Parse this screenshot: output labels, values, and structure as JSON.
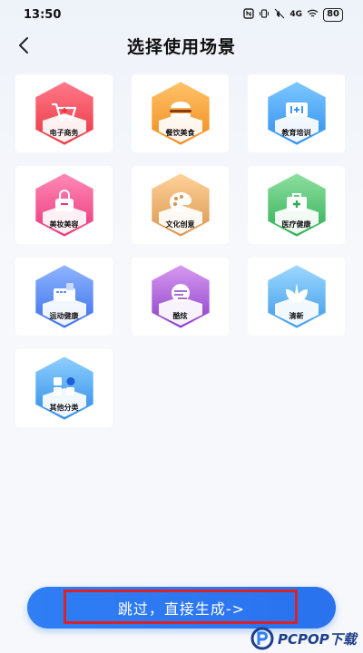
{
  "status_bar": {
    "time": "13:50",
    "icons": [
      "nfc-icon",
      "vibrate-icon",
      "mute-icon",
      "signal-4g-icon",
      "wifi-icon"
    ],
    "network": "4G",
    "battery": "80"
  },
  "header": {
    "title": "选择使用场景",
    "back_icon": "chevron-left-icon"
  },
  "scenes": [
    {
      "label": "电子商务",
      "icon": "cart-icon",
      "color_top": "#ff7a8a",
      "color_bottom": "#e9333f"
    },
    {
      "label": "餐饮美食",
      "icon": "burger-icon",
      "color_top": "#ffc36b",
      "color_bottom": "#f08a1a"
    },
    {
      "label": "教育培训",
      "icon": "education-icon",
      "color_top": "#7ec7ff",
      "color_bottom": "#2c8ef0"
    },
    {
      "label": "美妆美容",
      "icon": "beauty-bag-icon",
      "color_top": "#ff8ab8",
      "color_bottom": "#e93578"
    },
    {
      "label": "文化创意",
      "icon": "palette-icon",
      "color_top": "#ffd29a",
      "color_bottom": "#d9954d"
    },
    {
      "label": "医疗健康",
      "icon": "medical-kit-icon",
      "color_top": "#8fe0a0",
      "color_bottom": "#2fae55"
    },
    {
      "label": "运动健康",
      "icon": "sport-icon",
      "color_top": "#8eb5ff",
      "color_bottom": "#3b6ee9"
    },
    {
      "label": "酷炫",
      "icon": "cool-icon",
      "color_top": "#d79af0",
      "color_bottom": "#8a3dc9"
    },
    {
      "label": "清新",
      "icon": "leaf-icon",
      "color_top": "#9ed8ff",
      "color_bottom": "#3a9ae8"
    },
    {
      "label": "其他分类",
      "icon": "category-icon",
      "color_top": "#8fd0ff",
      "color_bottom": "#2d8ae6"
    }
  ],
  "cta": {
    "label": "跳过，直接生成->"
  },
  "watermark": {
    "text": "PCPOP下载"
  },
  "colors": {
    "accent": "#2f7ef4",
    "highlight_border": "#d9232a"
  }
}
